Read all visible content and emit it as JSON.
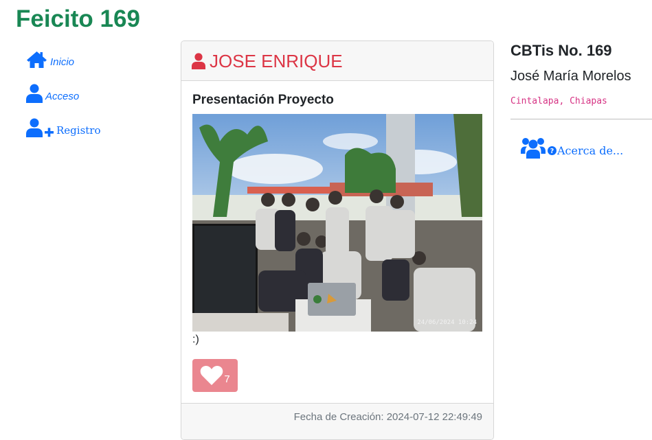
{
  "site": {
    "title": "Feicito 169"
  },
  "nav": [
    {
      "label": "Inicio",
      "icon": "home-icon"
    },
    {
      "label": "Acceso",
      "icon": "user-icon"
    },
    {
      "label": "Registro",
      "icon": "user-plus-icon"
    }
  ],
  "post": {
    "author": "JOSE ENRIQUE",
    "title": "Presentación Proyecto",
    "photo_timestamp": "24/06/2024  10:24",
    "caption": ":)",
    "likes": "7",
    "created": "Fecha de Creación: 2024-07-12 22:49:49"
  },
  "aside": {
    "school": "CBTis No. 169",
    "school_name": "José María Morelos",
    "city": "Cintalapa, Chiapas",
    "about_label": "Acerca de...",
    "about_icon": "users-icon"
  },
  "colors": {
    "brand": "#198754",
    "link": "#0d6efd",
    "author": "#dc3545",
    "like_button": "#ea868f",
    "city": "#d63384"
  }
}
